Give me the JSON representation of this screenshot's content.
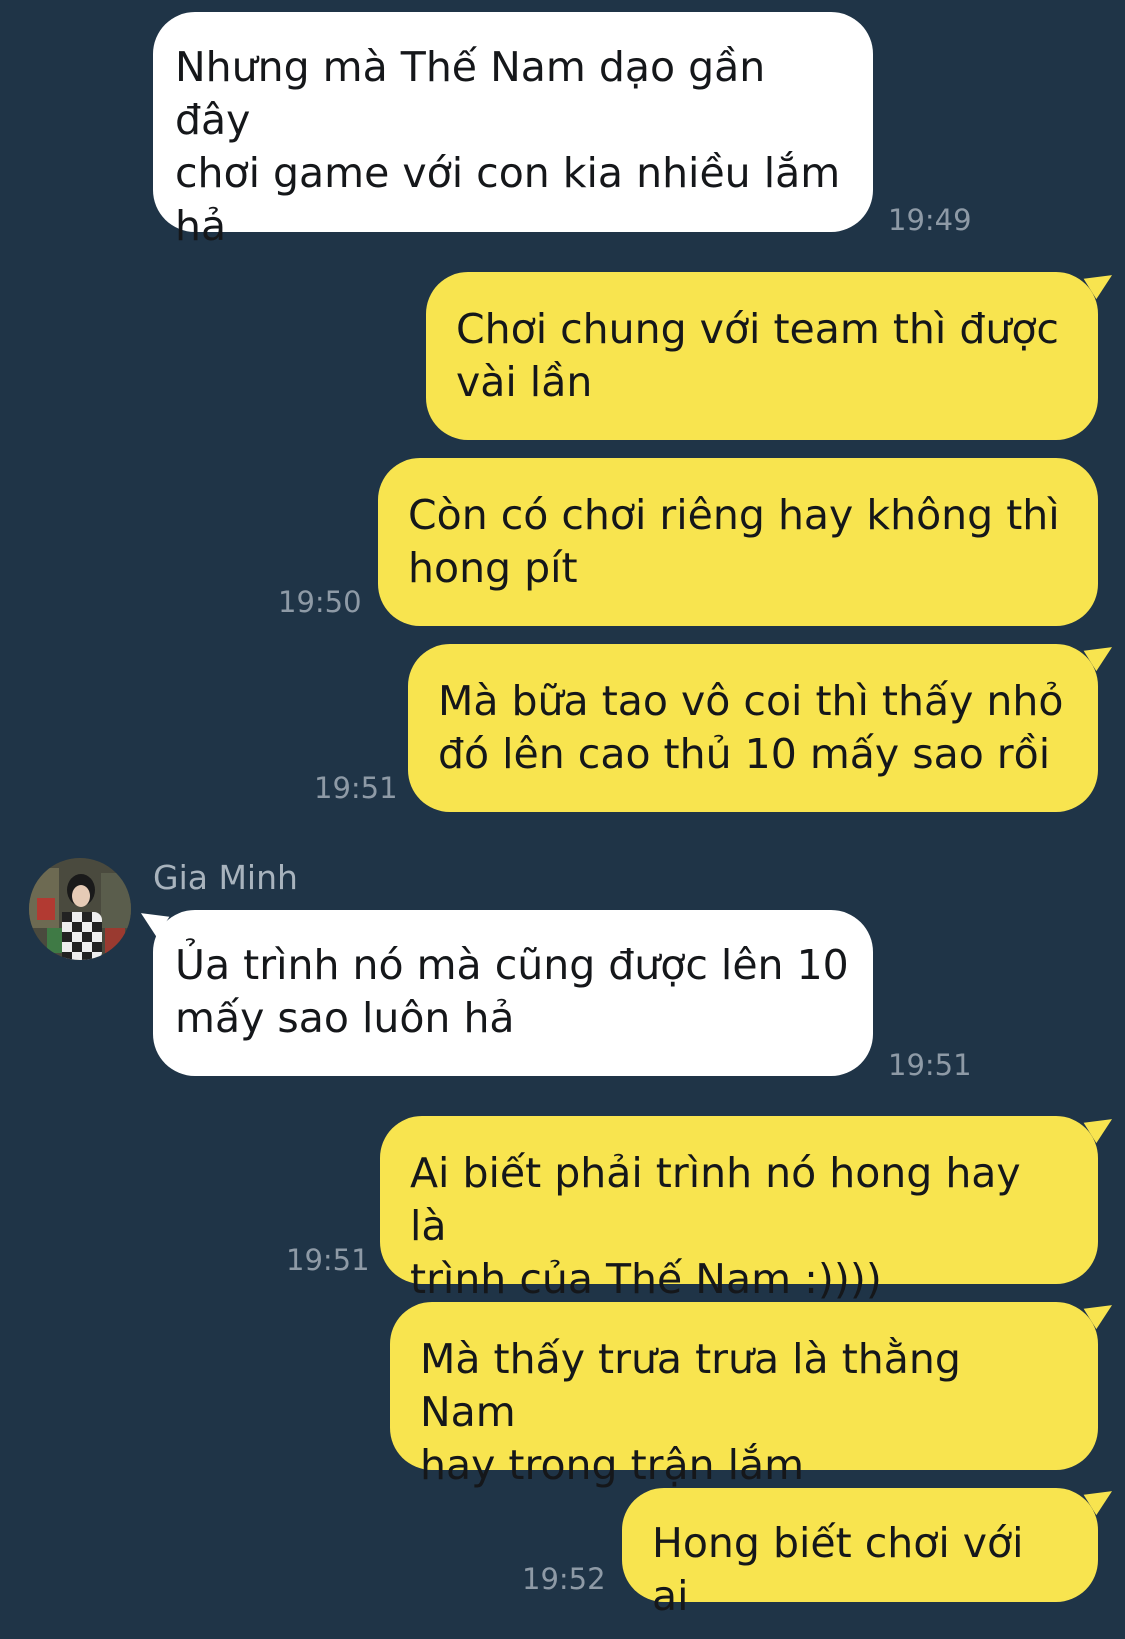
{
  "theme": {
    "background": "#1f3447",
    "incoming_bubble": "#ffffff",
    "outgoing_bubble": "#f8e44f",
    "timestamp_color": "#8e9aa6"
  },
  "contact": {
    "name": "Gia Minh",
    "avatar_icon": "user-photo-avatar"
  },
  "messages": [
    {
      "direction": "incoming",
      "text": "Nhưng mà Thế Nam dạo gần đây\nchơi game với con kia nhiều lắm\nhả",
      "time": "19:49"
    },
    {
      "direction": "outgoing",
      "text": "Chơi chung với team thì được\nvài lần",
      "time": ""
    },
    {
      "direction": "outgoing",
      "text": "Còn có chơi riêng hay không thì\nhong pít",
      "time": "19:50"
    },
    {
      "direction": "outgoing",
      "text": "Mà bữa tao vô coi thì thấy nhỏ\nđó lên cao thủ 10 mấy sao rồi",
      "time": "19:51"
    },
    {
      "direction": "incoming",
      "text": "Ủa trình nó mà cũng được lên 10\nmấy sao luôn hả",
      "time": "19:51"
    },
    {
      "direction": "outgoing",
      "text": "Ai biết phải trình nó hong hay là\ntrình của Thế Nam :))))",
      "time": "19:51"
    },
    {
      "direction": "outgoing",
      "text": "Mà thấy trưa trưa là thằng Nam\nhay trong trận lắm",
      "time": ""
    },
    {
      "direction": "outgoing",
      "text": "Hong biết chơi với ai",
      "time": "19:52"
    }
  ]
}
